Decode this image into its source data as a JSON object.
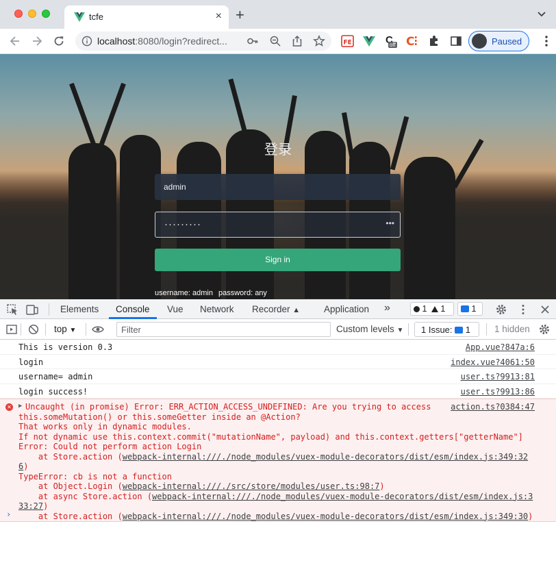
{
  "browser": {
    "tab_title": "tcfe",
    "tab_close": "×",
    "new_tab": "+",
    "url_host": "localhost",
    "url_rest": ":8080/login?redirect...",
    "profile_label": "Paused",
    "ext_off_label": "off"
  },
  "page": {
    "login_title": "登录",
    "username_value": "admin",
    "password_mask": "·········",
    "password_toggle": "•••",
    "signin_label": "Sign in",
    "hint_username": "username: admin",
    "hint_password": "password: any"
  },
  "devtools": {
    "tabs": [
      "Elements",
      "Console",
      "Vue",
      "Network",
      "Recorder",
      "Application"
    ],
    "more": "»",
    "errors_count": "1",
    "warnings_count": "1",
    "messages_count": "1",
    "context": "top",
    "filter_placeholder": "Filter",
    "levels": "Custom levels",
    "issues_label": "1 Issue:",
    "issues_count": "1",
    "hidden": "1 hidden",
    "logs": [
      {
        "msg": "This is version 0.3",
        "src": "App.vue?847a:6"
      },
      {
        "msg": "login",
        "src": "index.vue?4061:50"
      },
      {
        "msg": "username= admin",
        "src": "user.ts?9913:81"
      },
      {
        "msg": "login success!",
        "src": "user.ts?9913:86"
      }
    ],
    "error": {
      "src": "action.ts?0384:47",
      "l1": "Uncaught (in promise) Error: ERR_ACTION_ACCESS_UNDEFINED: Are you trying to access",
      "l2": "this.someMutation() or this.someGetter inside an @Action?",
      "l3": "That works only in dynamic modules.",
      "l4": "If not dynamic use this.context.commit(\"mutationName\", payload) and this.context.getters[\"getterName\"]",
      "l5": "Error: Could not perform action Login",
      "l6a": "    at Store.action (",
      "l6b": "webpack-internal:///./node_modules/vuex-module-decorators/dist/esm/index.js:349:32",
      "l7a": "6",
      "l7b": ")",
      "l8": "TypeError: cb is not a function",
      "l9a": "    at Object.Login (",
      "l9b": "webpack-internal:///./src/store/modules/user.ts:98:7",
      "l9c": ")",
      "l10a": "    at async Store.action (",
      "l10b": "webpack-internal:///./node_modules/vuex-module-decorators/dist/esm/index.js:3",
      "l11a": "33:27",
      "l11b": ")",
      "l12a": "    at Store.action (",
      "l12b": "webpack-internal:///./node_modules/vuex-module-decorators/dist/esm/index.js:349:30",
      "l12c": ")"
    },
    "prompt": "›"
  }
}
